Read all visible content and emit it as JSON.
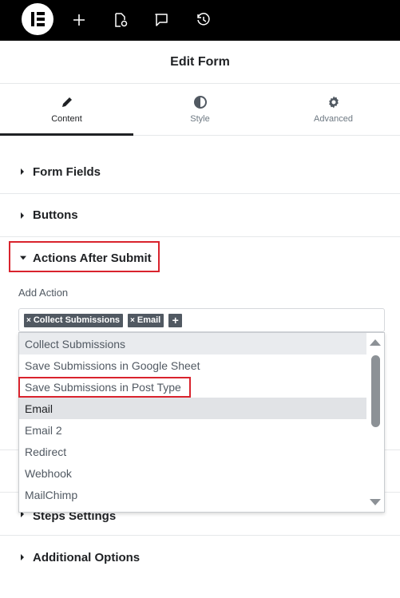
{
  "topbar": {
    "icons": [
      "elementor-logo-icon",
      "add-icon",
      "page-settings-icon",
      "comment-icon",
      "history-icon"
    ]
  },
  "header": {
    "title": "Edit Form"
  },
  "tabs": [
    {
      "label": "Content",
      "icon": "pencil-icon",
      "active": true
    },
    {
      "label": "Style",
      "icon": "half-circle-icon",
      "active": false
    },
    {
      "label": "Advanced",
      "icon": "gear-icon",
      "active": false
    }
  ],
  "sections": {
    "form_fields": "Form Fields",
    "buttons": "Buttons",
    "actions_after_submit": "Actions After Submit",
    "steps_settings": "Steps Settings",
    "additional_options": "Additional Options"
  },
  "add_action": {
    "label": "Add Action",
    "tags": [
      "Collect Submissions",
      "Email"
    ],
    "add_symbol": "+"
  },
  "dropdown": {
    "options": [
      "Collect Submissions",
      "Save Submissions in Google Sheet",
      "Save Submissions in Post Type",
      "Email",
      "Email 2",
      "Redirect",
      "Webhook",
      "MailChimp"
    ]
  },
  "colors": {
    "accent_outline": "#d9232d",
    "topbar_bg": "#000000",
    "tag_bg": "#515962"
  }
}
